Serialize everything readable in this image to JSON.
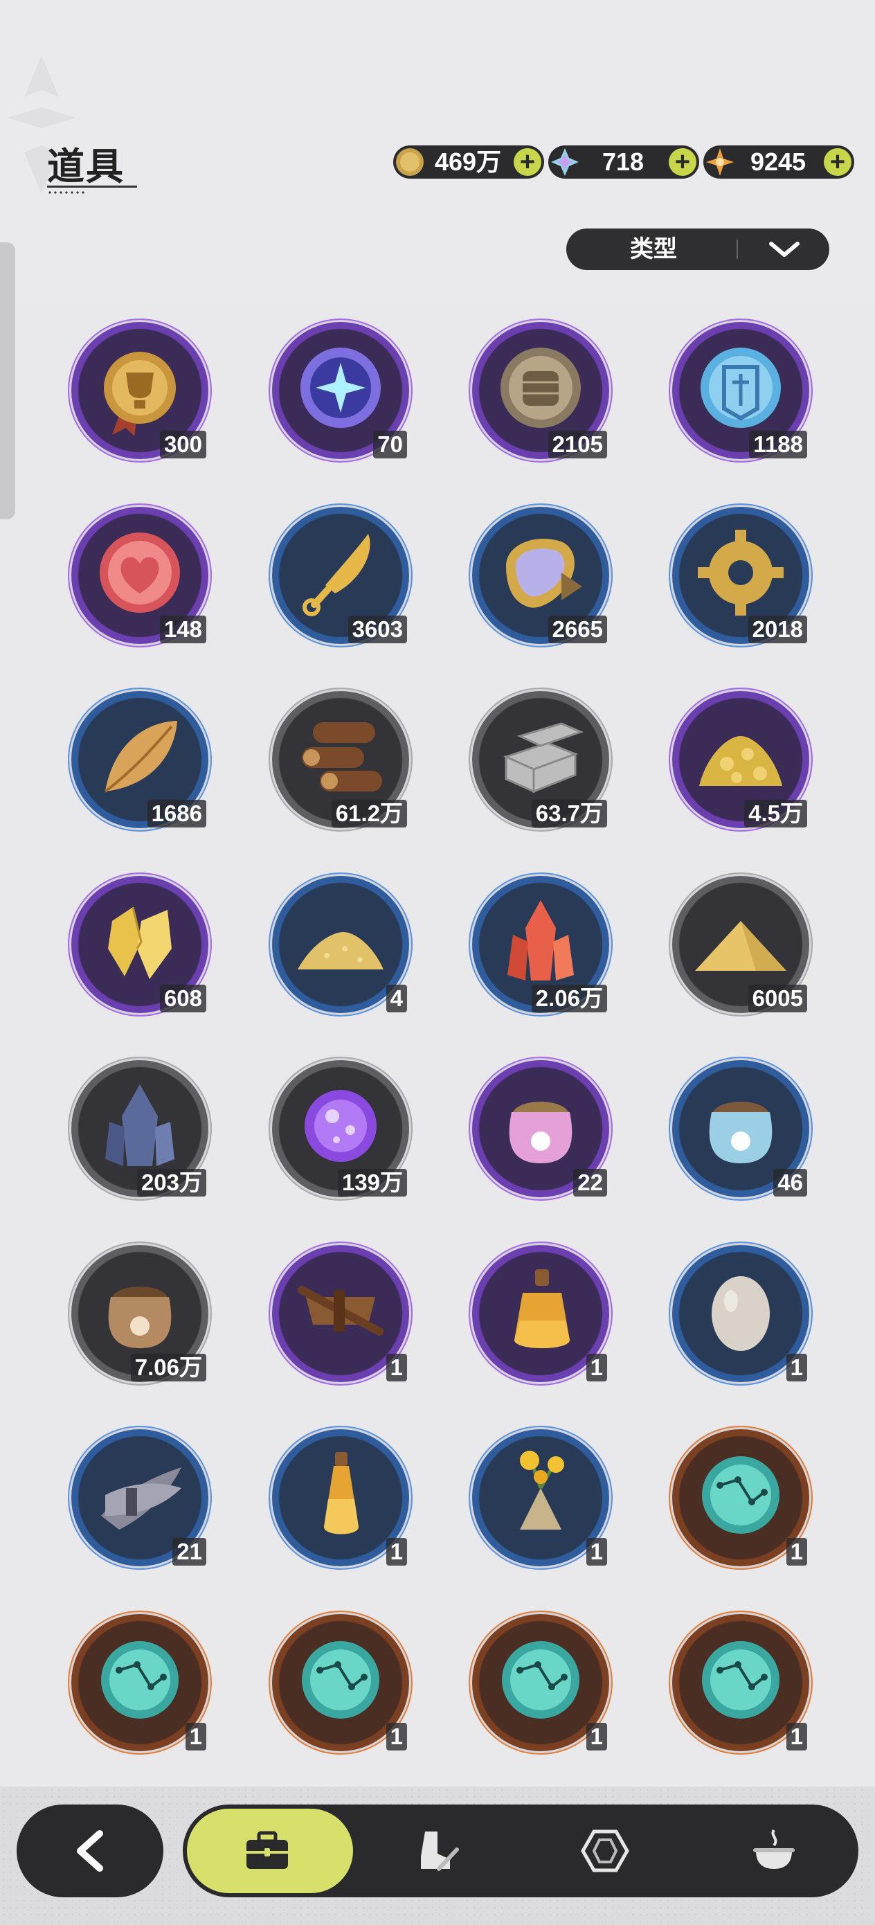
{
  "header": {
    "title": "道具",
    "currencies": [
      {
        "icon": "gold-coin-icon",
        "value": "469万"
      },
      {
        "icon": "crystal-icon",
        "value": "718"
      },
      {
        "icon": "star-jewel-icon",
        "value": "9245"
      }
    ],
    "filter": {
      "label": "类型"
    }
  },
  "items": [
    {
      "icon": "trophy-medal-icon",
      "rarity": "purple",
      "count": "300"
    },
    {
      "icon": "star-orb-icon",
      "rarity": "purple",
      "count": "70"
    },
    {
      "icon": "fist-coin-icon",
      "rarity": "purple",
      "count": "2105"
    },
    {
      "icon": "emblem-coin-icon",
      "rarity": "purple",
      "count": "1188"
    },
    {
      "icon": "heart-coin-icon",
      "rarity": "purple",
      "count": "148"
    },
    {
      "icon": "bone-blade-icon",
      "rarity": "blue",
      "count": "3603"
    },
    {
      "icon": "scale-shield-icon",
      "rarity": "blue",
      "count": "2665"
    },
    {
      "icon": "gear-icon",
      "rarity": "blue",
      "count": "2018"
    },
    {
      "icon": "leaf-icon",
      "rarity": "blue",
      "count": "1686"
    },
    {
      "icon": "log-bundle-icon",
      "rarity": "gray",
      "count": "61.2万"
    },
    {
      "icon": "stone-brick-icon",
      "rarity": "gray",
      "count": "63.7万"
    },
    {
      "icon": "gold-nugget-pile-icon",
      "rarity": "purple",
      "count": "4.5万"
    },
    {
      "icon": "gold-crystal-icon",
      "rarity": "purple",
      "count": "608"
    },
    {
      "icon": "gold-dust-pile-icon",
      "rarity": "blue",
      "count": "4"
    },
    {
      "icon": "red-crystal-icon",
      "rarity": "blue",
      "count": "2.06万"
    },
    {
      "icon": "sand-pile-icon",
      "rarity": "gray",
      "count": "6005"
    },
    {
      "icon": "dark-crystal-icon",
      "rarity": "gray",
      "count": "203万"
    },
    {
      "icon": "purple-orb-icon",
      "rarity": "gray",
      "count": "139万"
    },
    {
      "icon": "pink-food-bag-icon",
      "rarity": "purple",
      "count": "22"
    },
    {
      "icon": "blue-food-bag-icon",
      "rarity": "blue",
      "count": "46"
    },
    {
      "icon": "brown-food-bag-icon",
      "rarity": "gray",
      "count": "7.06万"
    },
    {
      "icon": "straw-bundle-icon",
      "rarity": "purple",
      "count": "1"
    },
    {
      "icon": "amber-flask-icon",
      "rarity": "purple",
      "count": "1"
    },
    {
      "icon": "egg-icon",
      "rarity": "blue",
      "count": "1"
    },
    {
      "icon": "feather-bundle-icon",
      "rarity": "blue",
      "count": "21"
    },
    {
      "icon": "potion-vial-icon",
      "rarity": "blue",
      "count": "1"
    },
    {
      "icon": "flower-bouquet-icon",
      "rarity": "blue",
      "count": "1"
    },
    {
      "icon": "constellation-orb-icon",
      "rarity": "orange",
      "count": "1"
    },
    {
      "icon": "constellation-orb-icon",
      "rarity": "orange",
      "count": "1"
    },
    {
      "icon": "constellation-orb-icon",
      "rarity": "orange",
      "count": "1"
    },
    {
      "icon": "constellation-orb-icon",
      "rarity": "orange",
      "count": "1"
    },
    {
      "icon": "constellation-orb-icon",
      "rarity": "orange",
      "count": "1"
    }
  ],
  "bottom_nav": {
    "back": "back-arrow-icon",
    "tabs": [
      {
        "icon": "toolbox-icon",
        "active": true
      },
      {
        "icon": "boot-sword-icon",
        "active": false
      },
      {
        "icon": "hexagon-gem-icon",
        "active": false
      },
      {
        "icon": "cauldron-icon",
        "active": false
      }
    ]
  },
  "colors": {
    "accent": "#d8e06c",
    "plus": "#c7d64a",
    "purple_rarity": "#a768ea",
    "blue_rarity": "#5a93e0",
    "gray_rarity": "#a9a9ad",
    "orange_rarity": "#e07d3a"
  }
}
